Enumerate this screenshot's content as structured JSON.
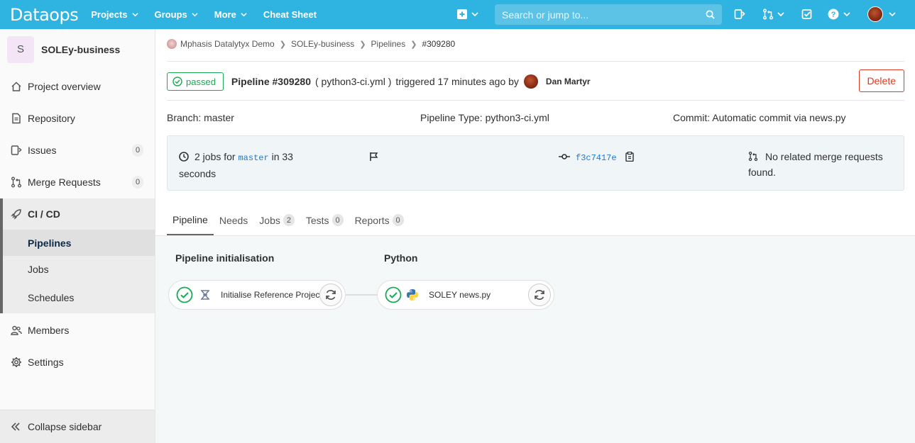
{
  "navbar": {
    "logo": "Dataops",
    "items": [
      {
        "label": "Projects",
        "caret": true
      },
      {
        "label": "Groups",
        "caret": true
      },
      {
        "label": "More",
        "caret": true
      },
      {
        "label": "Cheat Sheet",
        "caret": false
      }
    ],
    "search_placeholder": "Search or jump to...",
    "icons": [
      "plus-square-icon",
      "issues-icon",
      "merge-request-icon",
      "todo-icon",
      "help-icon",
      "user-avatar"
    ]
  },
  "sidebar": {
    "project_initial": "S",
    "project_name": "SOLEy-business",
    "items": [
      {
        "label": "Project overview",
        "icon": "home-icon"
      },
      {
        "label": "Repository",
        "icon": "doc-icon"
      },
      {
        "label": "Issues",
        "icon": "issues-icon",
        "count": "0"
      },
      {
        "label": "Merge Requests",
        "icon": "merge-request-icon",
        "count": "0"
      },
      {
        "label": "CI / CD",
        "icon": "rocket-icon"
      },
      {
        "label": "Members",
        "icon": "users-icon"
      },
      {
        "label": "Settings",
        "icon": "gear-icon"
      }
    ],
    "sub_items": [
      "Pipelines",
      "Jobs",
      "Schedules"
    ],
    "collapse_label": "Collapse sidebar"
  },
  "breadcrumb": {
    "items": [
      "Mphasis Datalytyx Demo",
      "SOLEy-business",
      "Pipelines",
      "#309280"
    ]
  },
  "pipeline": {
    "status": "passed",
    "title": "Pipeline #309280",
    "file_paren": "( python3-ci.yml )",
    "triggered_text": "triggered 17 minutes ago by",
    "user": "Dan Martyr",
    "delete_label": "Delete",
    "branch": "Branch: master",
    "type": "Pipeline Type: python3-ci.yml",
    "commit": "Commit: Automatic commit via news.py",
    "jobs_prefix": "2 jobs for",
    "jobs_branch": "master",
    "jobs_suffix": "in 33",
    "jobs_suffix2": "seconds",
    "commit_sha": "f3c7417e",
    "merge_text_1": "No related merge requests",
    "merge_text_2": "found."
  },
  "tabs": [
    {
      "label": "Pipeline",
      "count": null
    },
    {
      "label": "Needs",
      "count": null
    },
    {
      "label": "Jobs",
      "count": "2"
    },
    {
      "label": "Tests",
      "count": "0"
    },
    {
      "label": "Reports",
      "count": "0"
    }
  ],
  "stages": [
    {
      "title": "Pipeline initialisation",
      "job": "Initialise Reference Project",
      "icon": "dataops-icon"
    },
    {
      "title": "Python",
      "job": "SOLEY news.py",
      "icon": "python-icon"
    }
  ],
  "colors": {
    "navbar": "#2fb3e0",
    "success": "#1aaa55",
    "danger": "#db3b21",
    "link": "#1f78d1"
  }
}
